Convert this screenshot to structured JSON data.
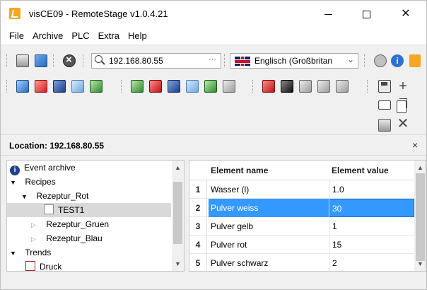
{
  "window": {
    "title": "visCE09 - RemoteStage v1.0.4.21"
  },
  "menu": {
    "items": [
      "File",
      "Archive",
      "PLC",
      "Extra",
      "Help"
    ]
  },
  "toolbar": {
    "address": "192.168.80.55",
    "address_dots": "···",
    "language": "Englisch (Großbritan"
  },
  "location": {
    "label": "Location: 192.168.80.55",
    "close": "×"
  },
  "tree": {
    "items": [
      {
        "label": "Event archive",
        "icon": "info-icon",
        "expander": ""
      },
      {
        "label": "Recipes",
        "icon": "",
        "expander": "▼"
      },
      {
        "label": "Rezeptur_Rot",
        "icon": "",
        "expander": "▼"
      },
      {
        "label": "TEST1",
        "icon": "document-icon",
        "expander": ""
      },
      {
        "label": "Rezeptur_Gruen",
        "icon": "",
        "expander": "▷"
      },
      {
        "label": "Rezeptur_Blau",
        "icon": "",
        "expander": "▷"
      },
      {
        "label": "Trends",
        "icon": "",
        "expander": "▼"
      },
      {
        "label": "Druck",
        "icon": "trend-icon",
        "expander": ""
      }
    ]
  },
  "grid": {
    "headers": {
      "name": "Element name",
      "value": "Element value"
    },
    "rows": [
      {
        "num": "1",
        "name": "Wasser (l)",
        "value": "1.0"
      },
      {
        "num": "2",
        "name": "Pulver weiss",
        "value": "30"
      },
      {
        "num": "3",
        "name": "Pulver gelb",
        "value": "1"
      },
      {
        "num": "4",
        "name": "Pulver rot",
        "value": "15"
      },
      {
        "num": "5",
        "name": "Pulver schwarz",
        "value": "2"
      }
    ],
    "selected_row": "2"
  },
  "colors": {
    "selection": "#3399ff",
    "accent_orange": "#f5a623"
  }
}
